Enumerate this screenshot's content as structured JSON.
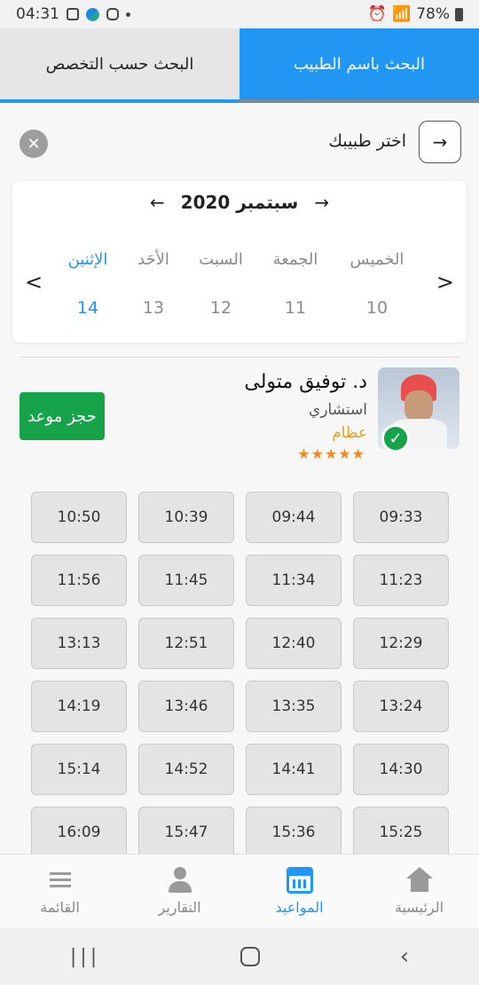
{
  "status_bar": {
    "time": "04:31",
    "battery": "78%"
  },
  "tabs": {
    "by_name": "البحث باسم الطبيب",
    "by_specialty": "البحث حسب التخصص"
  },
  "selector": {
    "label": "اختر طبيبك",
    "arrow": "→",
    "close": "✕"
  },
  "calendar": {
    "month_title": "سبتمبر 2020",
    "prev_month": "←",
    "next_month": "→",
    "nav_left": "<",
    "nav_right": ">",
    "days": [
      {
        "name": "الإثنين",
        "num": "14",
        "active": true
      },
      {
        "name": "الأحَد",
        "num": "13"
      },
      {
        "name": "السبت",
        "num": "12"
      },
      {
        "name": "الجمعة",
        "num": "11"
      },
      {
        "name": "الخميس",
        "num": "10"
      }
    ]
  },
  "doctor": {
    "name": "د. توفيق متولى",
    "title": "استشاري",
    "specialty": "عظام",
    "rating": 5,
    "stars": "★★★★★",
    "book_label": "حجز موعد"
  },
  "slots": [
    "09:33",
    "09:44",
    "10:39",
    "10:50",
    "11:23",
    "11:34",
    "11:45",
    "11:56",
    "12:29",
    "12:40",
    "12:51",
    "13:13",
    "13:24",
    "13:35",
    "13:46",
    "14:19",
    "14:30",
    "14:41",
    "14:52",
    "15:14",
    "15:25",
    "15:36",
    "15:47",
    "16:09"
  ],
  "bottom_nav": {
    "home": "الرئيسية",
    "appointments": "المواعيد",
    "reports": "التقارير",
    "menu": "القائمة"
  },
  "icons": {
    "home": "home-icon",
    "appointments": "calendar-icon",
    "reports": "user-icon",
    "menu": "menu-icon"
  },
  "colors": {
    "primary": "#2196f3",
    "book_button": "#16a34a",
    "specialty": "#e0a020",
    "stars": "#f08a24"
  }
}
